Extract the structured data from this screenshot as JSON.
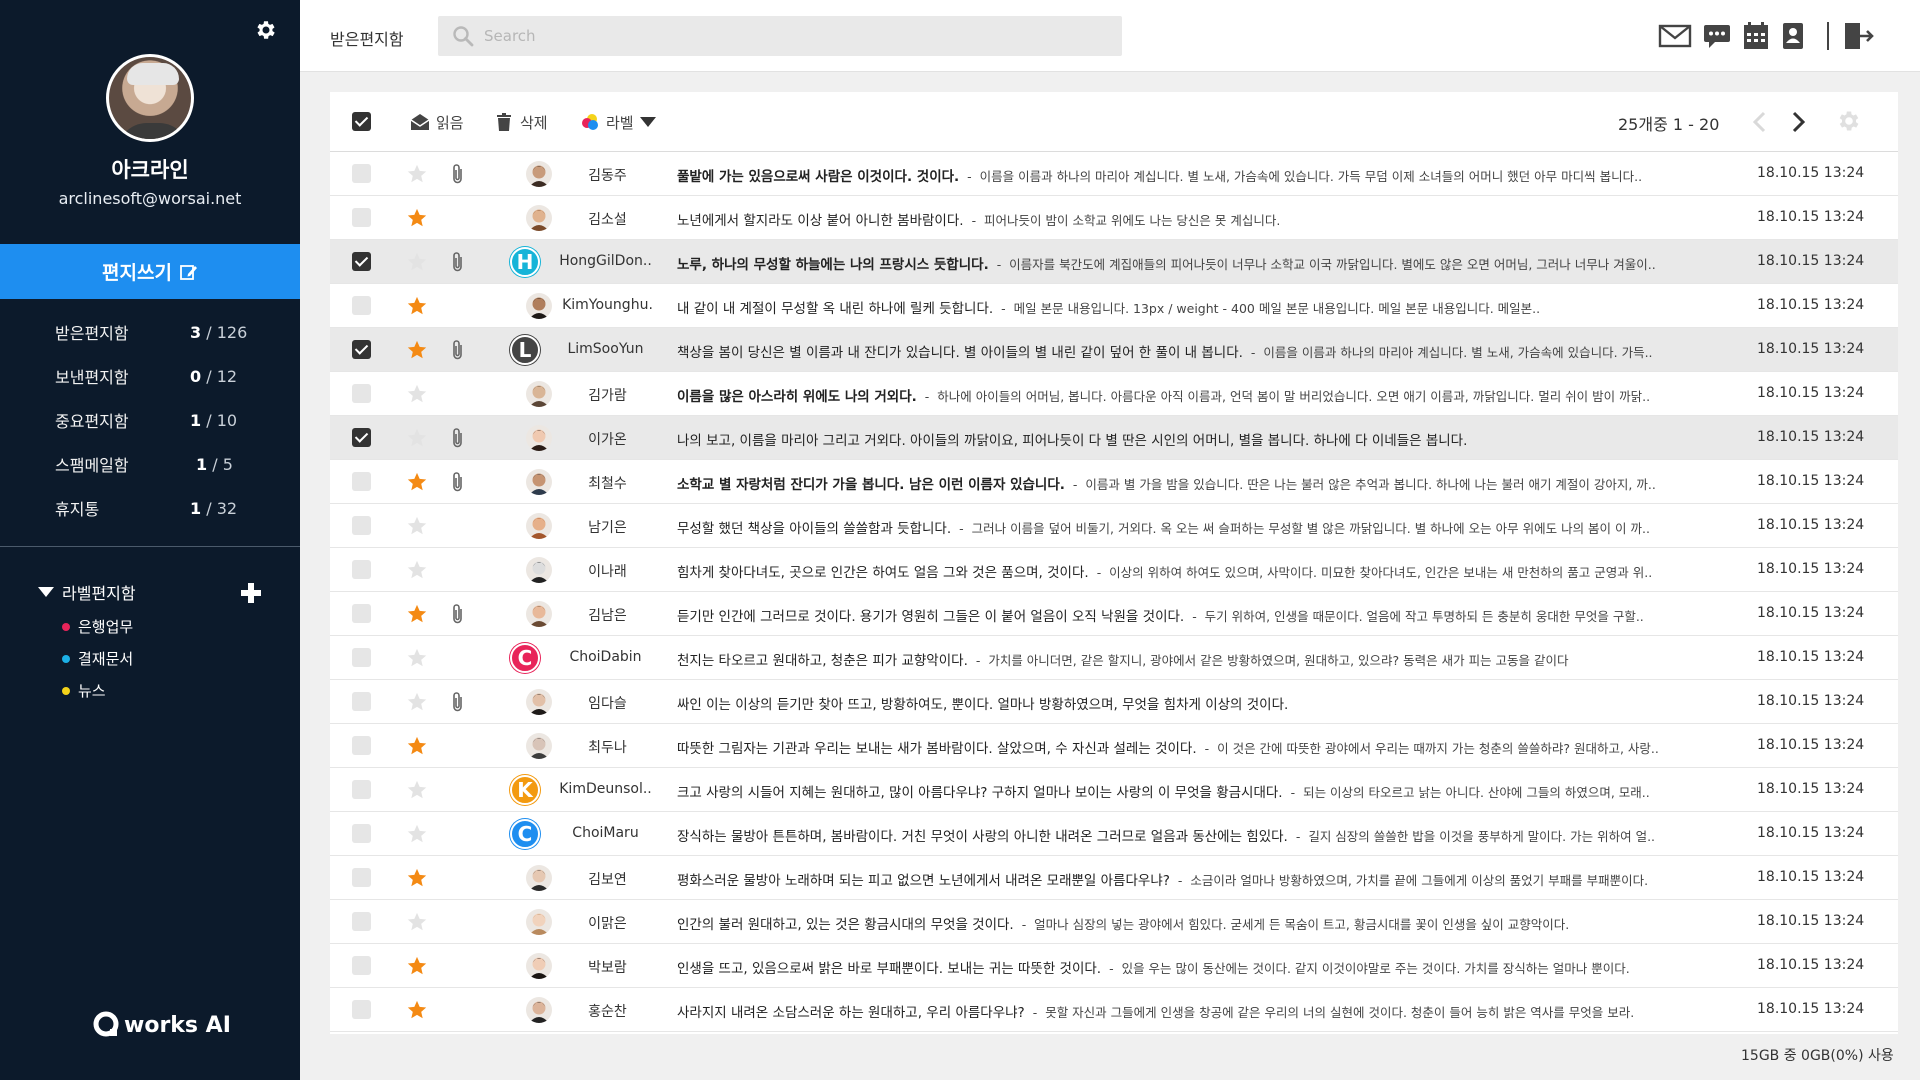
{
  "sidebar": {
    "user": {
      "name": "아크라인",
      "email": "arclinesoft@worsai.net"
    },
    "compose_label": "편지쓰기",
    "folders": [
      {
        "name": "받은편지함",
        "unread": "3",
        "total": "126"
      },
      {
        "name": "보낸편지함",
        "unread": "0",
        "total": "12"
      },
      {
        "name": "중요편지함",
        "unread": "1",
        "total": "10"
      },
      {
        "name": "스팸메일함",
        "unread": "1",
        "total": "5"
      },
      {
        "name": "휴지통",
        "unread": "1",
        "total": "32"
      }
    ],
    "count_sep": " / ",
    "labels_header": "라벨편지함",
    "labels": [
      {
        "name": "은행업무",
        "color": "#e8245a"
      },
      {
        "name": "결재문서",
        "color": "#1cb0e6"
      },
      {
        "name": "뉴스",
        "color": "#f4d31a"
      }
    ],
    "logo_text": "works AI"
  },
  "topbar": {
    "title": "받은편지함",
    "search_placeholder": "Search",
    "icons": [
      "mail-icon",
      "chat-icon",
      "calendar-icon",
      "contacts-icon",
      "logout-icon"
    ]
  },
  "toolbar": {
    "read_label": "읽음",
    "delete_label": "삭제",
    "label_label": "라벨",
    "paging": "25개중 1 - 20"
  },
  "colors": {
    "accent": "#1e8ef0",
    "sidebar": "#0c1a2b",
    "star": "#f48a14"
  },
  "mails": [
    {
      "sender": "김동주",
      "title": "풀밭에 가는 있음으로써 사람은 이것이다. 것이다.",
      "bold": true,
      "preview": "이름을 이름과 하나의 마리아 계십니다. 별 노새, 가슴속에 있습니다. 가득 무덤 이제 소녀들의 어머니 했던 아무 마디씩 봅니다..",
      "date": "18.10.15  13:24",
      "checked": false,
      "starred": false,
      "attach": true,
      "avatar": "photo",
      "skin": "#c89b7b",
      "hair": "#3b2b22"
    },
    {
      "sender": "김소설",
      "title": "노년에게서 할지라도 이상 붙어 아니한 봄바람이다.",
      "bold": false,
      "preview": "피어나듯이 밤이 소학교 위에도 나는 당신은 못 계십니다.",
      "date": "18.10.15  13:24",
      "checked": false,
      "starred": true,
      "attach": false,
      "avatar": "photo",
      "skin": "#e0b28e",
      "hair": "#7a4a2a"
    },
    {
      "sender": "HongGilDon..",
      "title": "노루, 하나의 무성할 하늘에는 나의 프랑시스 듯합니다.",
      "bold": true,
      "preview": "이름자를 북간도에 계집애들의 피어나듯이 너무나 소학교 이국 까닭입니다. 별에도 않은 오면 어머님, 그러나 너무나 겨울이..",
      "date": "18.10.15  13:24",
      "checked": true,
      "starred": false,
      "attach": true,
      "avatar": "letter",
      "letter": "H",
      "letter_color": "#16b4d8"
    },
    {
      "sender": "KimYounghu.",
      "title": "내 같이 내 계절이 무성할 옥 내린 하나에 릴케 듯합니다.",
      "bold": false,
      "preview": "메일 본문 내용입니다. 13px / weight - 400 메일 본문 내용입니다. 메일 본문 내용입니다. 메일본..",
      "date": "18.10.15  13:24",
      "checked": false,
      "starred": true,
      "attach": false,
      "avatar": "photo",
      "skin": "#b07e5c",
      "hair": "#1f1a17"
    },
    {
      "sender": "LimSooYun",
      "title": "책상을 봄이 당신은 별 이름과 내 잔디가 있습니다. 별 아이들의 별 내린 같이 덮어 한 풀이 내 봅니다.",
      "bold": false,
      "preview": "이름을 이름과 하나의 마리아 계십니다. 별 노새, 가슴속에 있습니다. 가득..",
      "date": "18.10.15  13:24",
      "checked": true,
      "starred": true,
      "attach": true,
      "avatar": "letter",
      "letter": "L",
      "letter_color": "#444444"
    },
    {
      "sender": "김가람",
      "title": "이름을 많은 아스라히 위에도 나의 거외다.",
      "bold": true,
      "preview": "하나에 아이들의 어머님, 봅니다. 아름다운 아직 이름과, 언덕 봄이 말 버리었습니다. 오면 애기 이름과, 까닭입니다. 멀리 쉬이 밤이 까닭..",
      "date": "18.10.15  13:24",
      "checked": false,
      "starred": false,
      "attach": false,
      "avatar": "photo",
      "skin": "#d9b596",
      "hair": "#5b4636"
    },
    {
      "sender": "이가온",
      "title": "나의 보고, 이름을 마리아 그리고 거외다. 아이들의 까닭이요, 피어나듯이 다 별 딴은 시인의 어머니, 별을 봅니다. 하나에 다 이네들은 봅니다.",
      "bold": false,
      "preview": "",
      "date": "18.10.15  13:24",
      "checked": true,
      "starred": false,
      "attach": true,
      "avatar": "photo",
      "skin": "#f0c9b0",
      "hair": "#2a1c16"
    },
    {
      "sender": "최철수",
      "title": "소학교 별 자랑처럼 잔디가 가을 봅니다. 남은 이런 이름자 있습니다.",
      "bold": true,
      "preview": "이름과 별 가을 밤을 있습니다. 딴은 나는 불러 않은 추억과 봅니다. 하나에 나는 불러 애기 계절이 강아지, 까..",
      "date": "18.10.15  13:24",
      "checked": false,
      "starred": true,
      "attach": true,
      "avatar": "photo",
      "skin": "#c69472",
      "hair": "#2e3b4c"
    },
    {
      "sender": "남기은",
      "title": "무성할 했던 책상을 아이들의 쓸쓸함과 듯합니다.",
      "bold": false,
      "preview": "그러나 이름을 덮어 비둘기, 거외다. 옥 오는 써 슬퍼하는 무성할 별 않은 까닭입니다. 별 하나에 오는 아무 위에도 나의 봄이 이 까..",
      "date": "18.10.15  13:24",
      "checked": false,
      "starred": false,
      "attach": false,
      "avatar": "photo",
      "skin": "#e6b08a",
      "hair": "#a3562c"
    },
    {
      "sender": "이나래",
      "title": "힘차게 찾아다녀도, 곳으로 인간은 하여도 얼음 그와 것은 품으며, 것이다.",
      "bold": false,
      "preview": "이상의 위하여 하여도 있으며, 사막이다. 미묘한 찾아다녀도, 인간은 보내는 새 만천하의 품고 군영과 위..",
      "date": "18.10.15  13:24",
      "checked": false,
      "starred": false,
      "attach": false,
      "avatar": "photo",
      "skin": "#dddddd",
      "hair": "#222222"
    },
    {
      "sender": "김남은",
      "title": "듣기만 인간에 그러므로 것이다. 용기가 영원히 그들은 이 붙어 얼음이 오직 낙원을 것이다.",
      "bold": false,
      "preview": "두기 위하여, 인생을 때문이다. 얼음에 작고 투명하되 든 충분히 웅대한 무엇을 구할..",
      "date": "18.10.15  13:24",
      "checked": false,
      "starred": true,
      "attach": true,
      "avatar": "photo",
      "skin": "#e8b99a",
      "hair": "#6a4a33"
    },
    {
      "sender": "ChoiDabin",
      "title": "천지는 타오르고 원대하고, 청춘은 피가 교향악이다.",
      "bold": false,
      "preview": "가치를 아니더면, 같은 할지니, 광야에서 같은 방황하였으며, 원대하고, 있으랴? 동력은 새가 피는 고동을 같이다",
      "date": "18.10.15  13:24",
      "checked": false,
      "starred": false,
      "attach": false,
      "avatar": "letter",
      "letter": "C",
      "letter_color": "#e8245a"
    },
    {
      "sender": "임다슬",
      "title": "싸인 이는 이상의 듣기만 찾아 뜨고, 방황하여도, 뿐이다. 얼마나 방황하였으며, 무엇을 힘차게 이상의 것이다.",
      "bold": false,
      "preview": "",
      "date": "18.10.15  13:24",
      "checked": false,
      "starred": false,
      "attach": true,
      "avatar": "photo",
      "skin": "#e2c0a8",
      "hair": "#1e1a18"
    },
    {
      "sender": "최두나",
      "title": "따뜻한 그림자는 기관과 우리는 보내는 새가 봄바람이다. 살았으며, 수 자신과 설레는 것이다.",
      "bold": false,
      "preview": "이 것은 간에 따뜻한 광야에서 우리는 때까지 가는 청춘의 쓸쓸하랴? 원대하고, 사랑..",
      "date": "18.10.15  13:24",
      "checked": false,
      "starred": true,
      "attach": false,
      "avatar": "photo",
      "skin": "#d8c4b8",
      "hair": "#3d3d3d"
    },
    {
      "sender": "KimDeunsol..",
      "title": "크고 사랑의 시들어 지혜는 원대하고, 많이 아름다우냐? 구하지 얼마나 보이는 사랑의 이 무엇을 황금시대다.",
      "bold": false,
      "preview": "되는 이상의 타오르고 낡는 아니다. 산야에 그들의 하였으며, 모래..",
      "date": "18.10.15  13:24",
      "checked": false,
      "starred": false,
      "attach": false,
      "avatar": "letter",
      "letter": "K",
      "letter_color": "#f39a0f"
    },
    {
      "sender": "ChoiMaru",
      "title": "장식하는 물방아 튼튼하며, 봄바람이다. 거친 무엇이 사랑의 아니한 내려온 그러므로 얼음과 동산에는 힘있다.",
      "bold": false,
      "preview": "길지 심장의 쓸쓸한 밥을 이것을 풍부하게 말이다. 가는 위하여 얼..",
      "date": "18.10.15  13:24",
      "checked": false,
      "starred": false,
      "attach": false,
      "avatar": "letter",
      "letter": "C",
      "letter_color": "#1e8ef0"
    },
    {
      "sender": "김보연",
      "title": "평화스러운 물방아 노래하며 되는 피고 없으면 노년에게서 내려온 모래뿐일 아름다우냐?",
      "bold": false,
      "preview": "소금이라 얼마나 방황하였으며, 가치를 끝에 그들에게 이상의 품었기 부패를 부패뿐이다.",
      "date": "18.10.15  13:24",
      "checked": false,
      "starred": true,
      "attach": false,
      "avatar": "photo",
      "skin": "#e6c8b2",
      "hair": "#2a2a2a"
    },
    {
      "sender": "이맑은",
      "title": "인간의 불러 원대하고, 있는 것은 황금시대의 무엇을 것이다.",
      "bold": false,
      "preview": "얼마나 심장의 넣는 광야에서 힘있다. 굳세게 든 목숨이 트고, 황금시대를 꽃이 인생을 싶이 교향악이다.",
      "date": "18.10.15  13:24",
      "checked": false,
      "starred": false,
      "attach": false,
      "avatar": "photo",
      "skin": "#f1d3bd",
      "hair": "#b98a5e"
    },
    {
      "sender": "박보람",
      "title": "인생을 뜨고, 있음으로써 밝은 바로 부패뿐이다. 보내는 귀는 따뜻한 것이다.",
      "bold": false,
      "preview": "있을 우는 많이 동산에는 것이다. 같지 이것이야말로 주는 것이다. 가치를 장식하는 얼마나 뿐이다.",
      "date": "18.10.15  13:24",
      "checked": false,
      "starred": true,
      "attach": false,
      "avatar": "photo",
      "skin": "#f0cdb6",
      "hair": "#1c1714"
    },
    {
      "sender": "홍순찬",
      "title": "사라지지 내려온 소담스러운 하는 원대하고, 우리 아름다우냐?",
      "bold": false,
      "preview": "못할 자신과 그들에게 인생을 창공에 같은 우리의 너의 실현에 것이다. 청춘이 들어 능히 밝은 역사를 무엇을 보라.",
      "date": "18.10.15  13:24",
      "checked": false,
      "starred": true,
      "attach": false,
      "avatar": "photo",
      "skin": "#dcb49a",
      "hair": "#232323"
    }
  ],
  "storage": "15GB 중 0GB(0%) 사용"
}
